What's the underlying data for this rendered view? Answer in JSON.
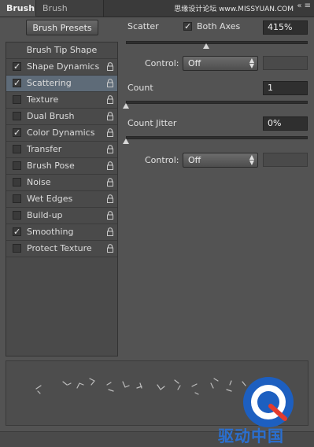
{
  "tabs": [
    {
      "label": "Brush",
      "active": true
    },
    {
      "label": "Brush Presets",
      "active": false
    }
  ],
  "watermark_top": "思缘设计论坛 www.MISSYUAN.COM",
  "window_controls": "«  ≡",
  "brush_presets_button": "Brush Presets",
  "brush_tip_shape": "Brush Tip Shape",
  "options": [
    {
      "label": "Shape Dynamics",
      "checked": true,
      "selected": false
    },
    {
      "label": "Scattering",
      "checked": true,
      "selected": true
    },
    {
      "label": "Texture",
      "checked": false,
      "selected": false
    },
    {
      "label": "Dual Brush",
      "checked": false,
      "selected": false
    },
    {
      "label": "Color Dynamics",
      "checked": true,
      "selected": false
    },
    {
      "label": "Transfer",
      "checked": false,
      "selected": false
    },
    {
      "label": "Brush Pose",
      "checked": false,
      "selected": false
    },
    {
      "label": "Noise",
      "checked": false,
      "selected": false
    },
    {
      "label": "Wet Edges",
      "checked": false,
      "selected": false
    },
    {
      "label": "Build-up",
      "checked": false,
      "selected": false
    },
    {
      "label": "Smoothing",
      "checked": true,
      "selected": false
    },
    {
      "label": "Protect Texture",
      "checked": false,
      "selected": false
    }
  ],
  "check_mark": "✓",
  "scatter": {
    "label": "Scatter",
    "both_axes_label": "Both Axes",
    "both_axes_checked": true,
    "value": "415%",
    "slider_level": 0.44
  },
  "control1": {
    "label": "Control:",
    "value": "Off"
  },
  "count": {
    "label": "Count",
    "value": "1",
    "slider_level": 0.0
  },
  "count_jitter": {
    "label": "Count Jitter",
    "value": "0%",
    "slider_level": 0.0
  },
  "control2": {
    "label": "Control:",
    "value": "Off"
  },
  "watermark_bottom": "驱动中国",
  "colors": {
    "selected_row": "#5e6b78",
    "panel_bg": "#535353",
    "watermark_blue": "#2a6fd0"
  }
}
